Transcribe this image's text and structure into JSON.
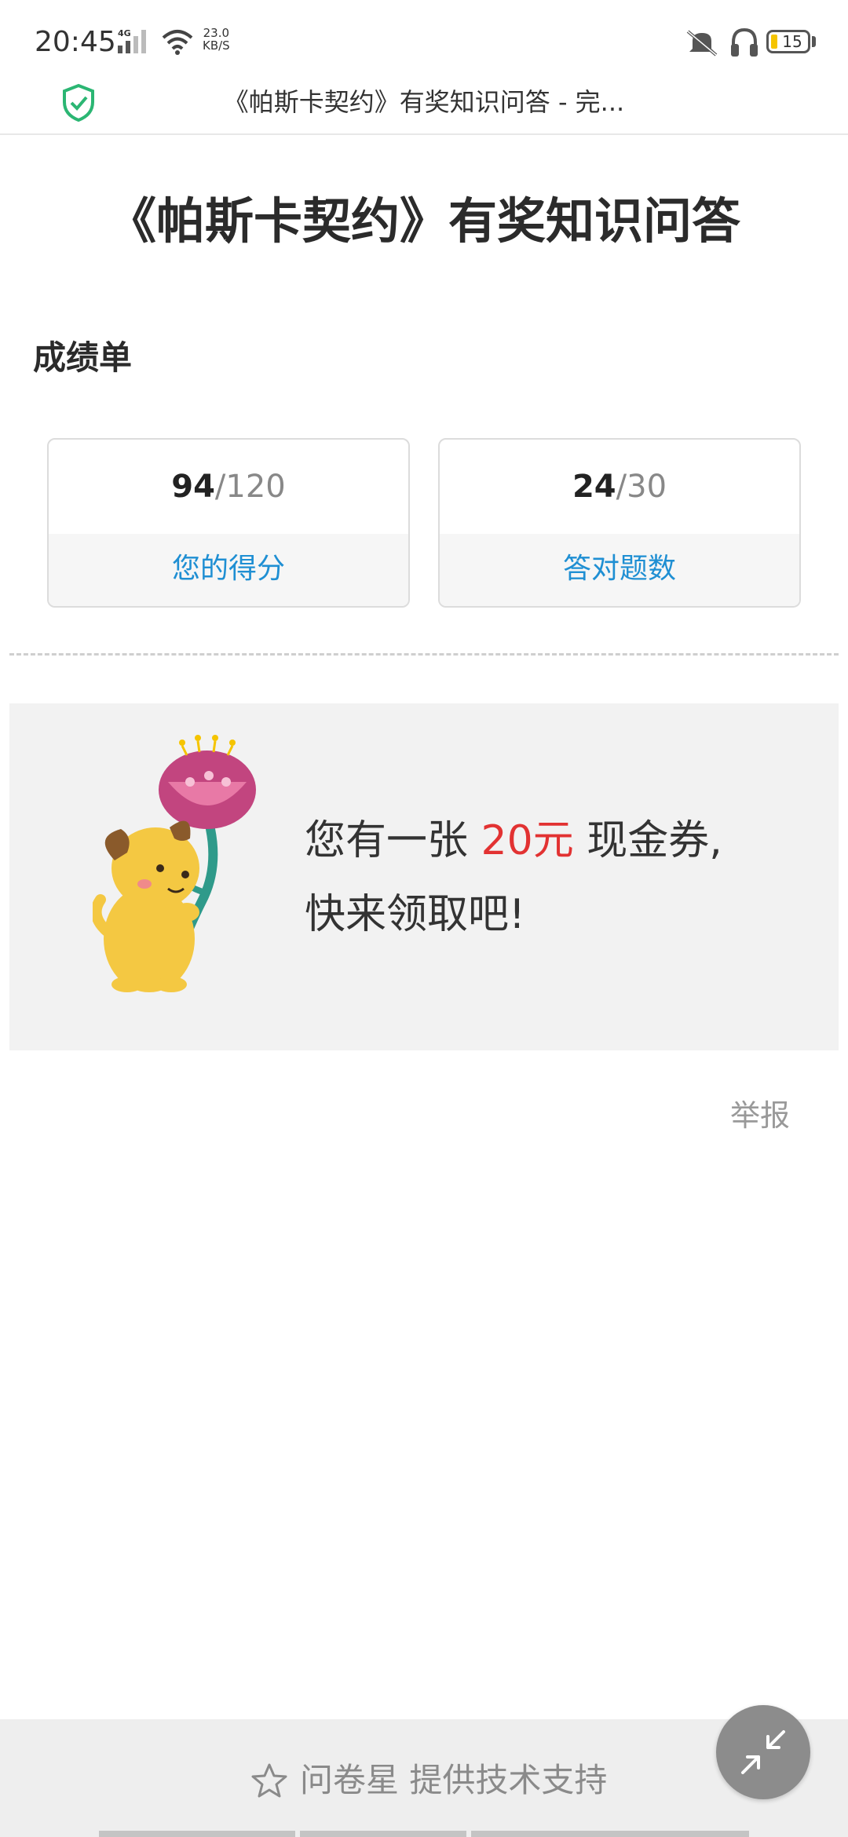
{
  "status_bar": {
    "time": "20:45",
    "network_type": "4G",
    "speed_value": "23.0",
    "speed_unit": "KB/S",
    "battery_level": "15",
    "icons": [
      "signal-icon",
      "wifi-icon",
      "mute-icon",
      "headset-icon",
      "battery-icon"
    ]
  },
  "browser": {
    "page_title": "《帕斯卡契约》有奖知识问答 - 完...",
    "secure_icon": "shield-check-icon",
    "accent_color": "#2bb673"
  },
  "survey": {
    "title": "《帕斯卡契约》有奖知识问答",
    "scorecard_heading": "成绩单",
    "score": {
      "value": "94",
      "total": "/120",
      "label": "您的得分"
    },
    "correct": {
      "value": "24",
      "total": "/30",
      "label": "答对题数"
    },
    "label_color": "#1f8fd3"
  },
  "coupon": {
    "line1_prefix": "您有一张 ",
    "amount": "20元",
    "line1_suffix": " 现金券,",
    "line2": "快来领取吧!",
    "amount_color": "#e23232",
    "illustration_icon": "dog-with-flower-illustration"
  },
  "report_link": "举报",
  "footer": {
    "text": "问卷星 提供技术支持",
    "icon": "star-outline-icon"
  },
  "collapse_icon": "collapse-arrows-icon"
}
